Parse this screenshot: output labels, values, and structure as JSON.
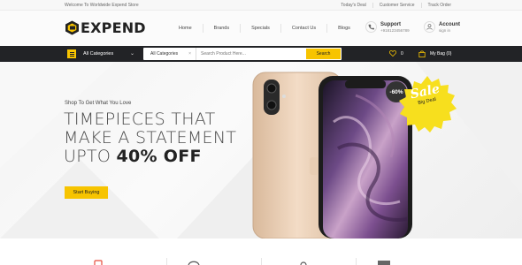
{
  "topbar": {
    "welcome": "Welcome To Worldwide Expend Store",
    "links": [
      "Today's Deal",
      "Customer Service",
      "Track Order"
    ]
  },
  "brand": {
    "name": "EXPEND"
  },
  "nav": [
    "Home",
    "Brands",
    "Specials",
    "Contact Us",
    "Blogs"
  ],
  "support": {
    "title": "Support",
    "phone": "+918123456789",
    "icon": "phone-icon"
  },
  "account": {
    "title": "Account",
    "sub": "sign in",
    "icon": "user-icon"
  },
  "searchbar": {
    "categories_label": "All Categories",
    "category_select": "All Categories",
    "search_placeholder": "Search Product Here...",
    "search_button": "Search",
    "wishlist_count": "0",
    "bag_label": "My Bag (0)"
  },
  "hero": {
    "kicker": "Shop To Get What You Love",
    "headline_line1": "TIMEPIECES THAT",
    "headline_line2": "MAKE A STATEMENT",
    "headline_line3_prefix": "UPTO",
    "headline_line3_bold": "40% OFF",
    "cta": "Start Buying",
    "discount_badge": "-60%",
    "sale_title": "Sale",
    "sale_sub": "Big Deal"
  },
  "colors": {
    "accent": "#f7c400",
    "dark_bar": "#222326"
  }
}
